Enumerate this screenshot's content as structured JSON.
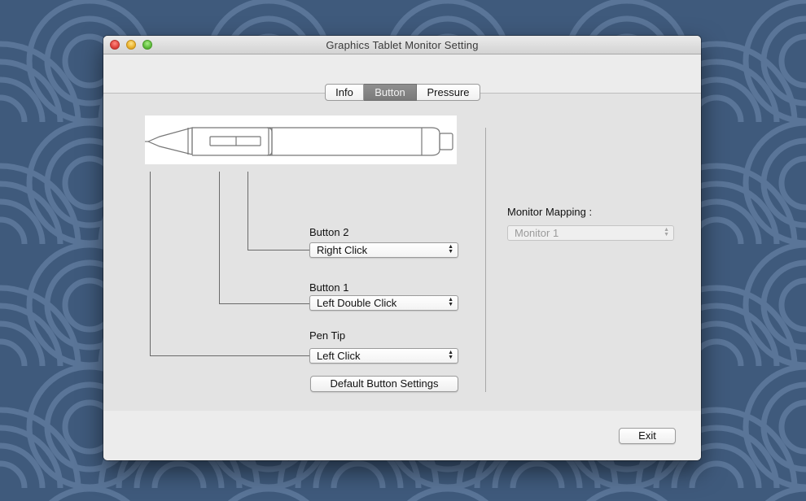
{
  "window": {
    "title": "Graphics Tablet Monitor Setting"
  },
  "tabs": [
    {
      "label": "Info",
      "active": false
    },
    {
      "label": "Button",
      "active": true
    },
    {
      "label": "Pressure",
      "active": false
    }
  ],
  "button_settings": {
    "button2": {
      "label": "Button 2",
      "value": "Right Click"
    },
    "button1": {
      "label": "Button 1",
      "value": "Left Double Click"
    },
    "pen_tip": {
      "label": "Pen Tip",
      "value": "Left Click"
    },
    "default_button_label": "Default Button Settings"
  },
  "monitor_mapping": {
    "label": "Monitor Mapping :",
    "value": "Monitor 1",
    "enabled": false
  },
  "footer": {
    "exit_label": "Exit"
  },
  "icons": {
    "close": "close-traffic-light-icon",
    "minimize": "minimize-traffic-light-icon",
    "zoom": "zoom-traffic-light-icon",
    "pen": "stylus-pen-illustration-icon",
    "popup_arrows": "up-down-chevron-icon"
  },
  "colors": {
    "desktop_bg": "#3f5a7c",
    "window_bg": "#ececec",
    "panel_bg": "#e3e3e3",
    "active_tab": "#7f7f7f",
    "close_light": "#e0443e",
    "minimize_light": "#e9b22e",
    "zoom_light": "#5fbe3c"
  }
}
